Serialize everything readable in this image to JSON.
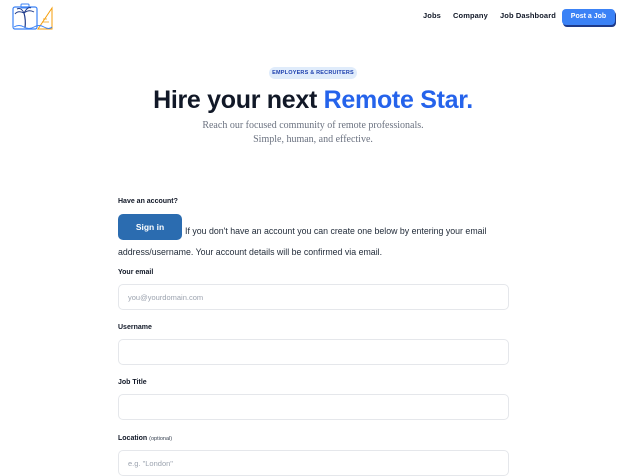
{
  "nav": {
    "jobs": "Jobs",
    "company": "Company",
    "dashboard": "Job Dashboard",
    "post_job": "Post a Job"
  },
  "hero": {
    "badge": "EMPLOYERS & RECRUITERS",
    "title_main": "Hire your next ",
    "title_accent": "Remote Star.",
    "subtitle_line1": "Reach our focused community of remote professionals.",
    "subtitle_line2": "Simple, human, and effective."
  },
  "form": {
    "have_account": "Have an account?",
    "sign_in": "Sign in",
    "info": "If you don't have an account you can create one below by entering your email address/username. Your account details will be confirmed via email.",
    "email_label": "Your email",
    "email_placeholder": "you@yourdomain.com",
    "username_label": "Username",
    "username_value": "",
    "job_title_label": "Job Title",
    "job_title_value": "",
    "location_label": "Location",
    "location_optional": "(optional)",
    "location_placeholder": "e.g. \"London\""
  },
  "colors": {
    "accent": "#2563eb",
    "button": "#3b82f6",
    "signin": "#2b6cb0"
  }
}
